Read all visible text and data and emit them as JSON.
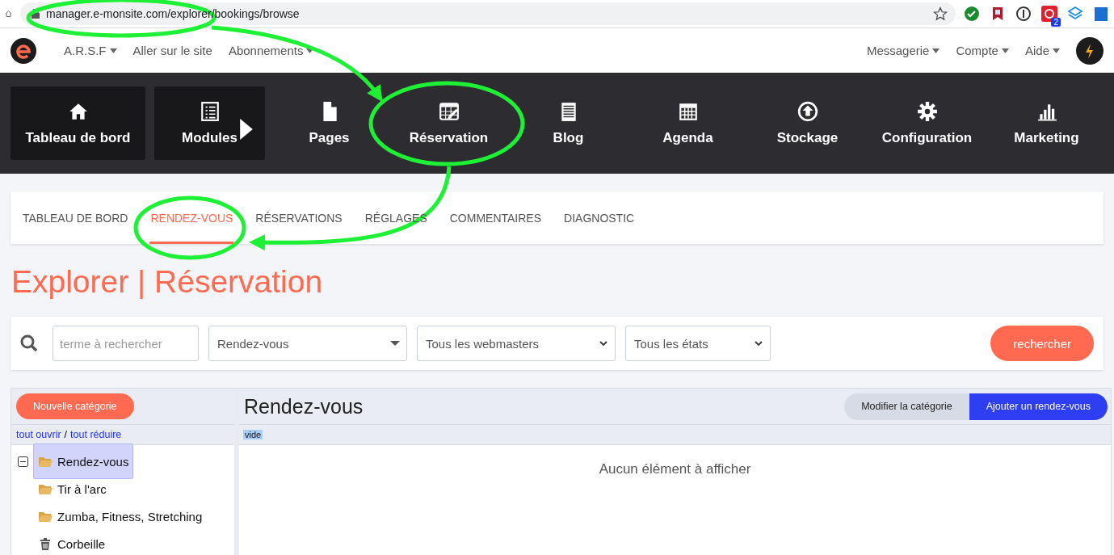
{
  "browser": {
    "url": "manager.e-monsite.com/explorer/bookings/browse",
    "extension_badge": "2"
  },
  "topnav": {
    "left": [
      {
        "label": "A.R.S.F",
        "dropdown": true
      },
      {
        "label": "Aller sur le site",
        "dropdown": false
      },
      {
        "label": "Abonnements",
        "dropdown": true
      }
    ],
    "right": [
      {
        "label": "Messagerie",
        "dropdown": true
      },
      {
        "label": "Compte",
        "dropdown": true
      },
      {
        "label": "Aide",
        "dropdown": true
      }
    ]
  },
  "modules": [
    {
      "label": "Tableau de bord",
      "boxed": true,
      "submenu": false
    },
    {
      "label": "Modules",
      "boxed": true,
      "submenu": true
    },
    {
      "label": "Pages",
      "boxed": false,
      "submenu": false
    },
    {
      "label": "Réservation",
      "boxed": false,
      "submenu": false
    },
    {
      "label": "Blog",
      "boxed": false,
      "submenu": false
    },
    {
      "label": "Agenda",
      "boxed": false,
      "submenu": false
    },
    {
      "label": "Stockage",
      "boxed": false,
      "submenu": false
    },
    {
      "label": "Configuration",
      "boxed": false,
      "submenu": false
    },
    {
      "label": "Marketing",
      "boxed": false,
      "submenu": false
    }
  ],
  "tabs": [
    {
      "label": "TABLEAU DE BORD",
      "selected": false
    },
    {
      "label": "RENDEZ-VOUS",
      "selected": true
    },
    {
      "label": "RÉSERVATIONS",
      "selected": false
    },
    {
      "label": "RÉGLAGES",
      "selected": false
    },
    {
      "label": "COMMENTAIRES",
      "selected": false
    },
    {
      "label": "DIAGNOSTIC",
      "selected": false
    }
  ],
  "page_title": "Explorer | Réservation",
  "search": {
    "placeholder": "terme à rechercher",
    "selects": [
      {
        "value": "Rendez-vous",
        "kind": "triangle"
      },
      {
        "value": "Tous les webmasters",
        "kind": "chevron"
      },
      {
        "value": "Tous les états",
        "kind": "chevron"
      }
    ],
    "button": "rechercher"
  },
  "sidebar": {
    "new_button": "Nouvelle catégorie",
    "open_all": "tout ouvrir",
    "separator": "/",
    "collapse_all": "tout réduire",
    "tree": [
      {
        "label": "Rendez-vous",
        "kind": "folder",
        "expanded": true,
        "selected": true,
        "children": [
          {
            "label": "Tir à l'arc",
            "kind": "folder",
            "selected": false
          },
          {
            "label": "Zumba, Fitness, Stretching",
            "kind": "folder",
            "selected": false
          }
        ]
      },
      {
        "label": "Corbeille",
        "kind": "trash",
        "selected": false
      }
    ]
  },
  "content": {
    "title": "Rendez-vous",
    "buttons": [
      {
        "label": "Modifier la catégorie",
        "kind": "secondary"
      },
      {
        "label": "Ajouter un rendez-vous",
        "kind": "primary"
      }
    ],
    "column_1": "vide",
    "empty_message": "Aucun élément à afficher"
  }
}
